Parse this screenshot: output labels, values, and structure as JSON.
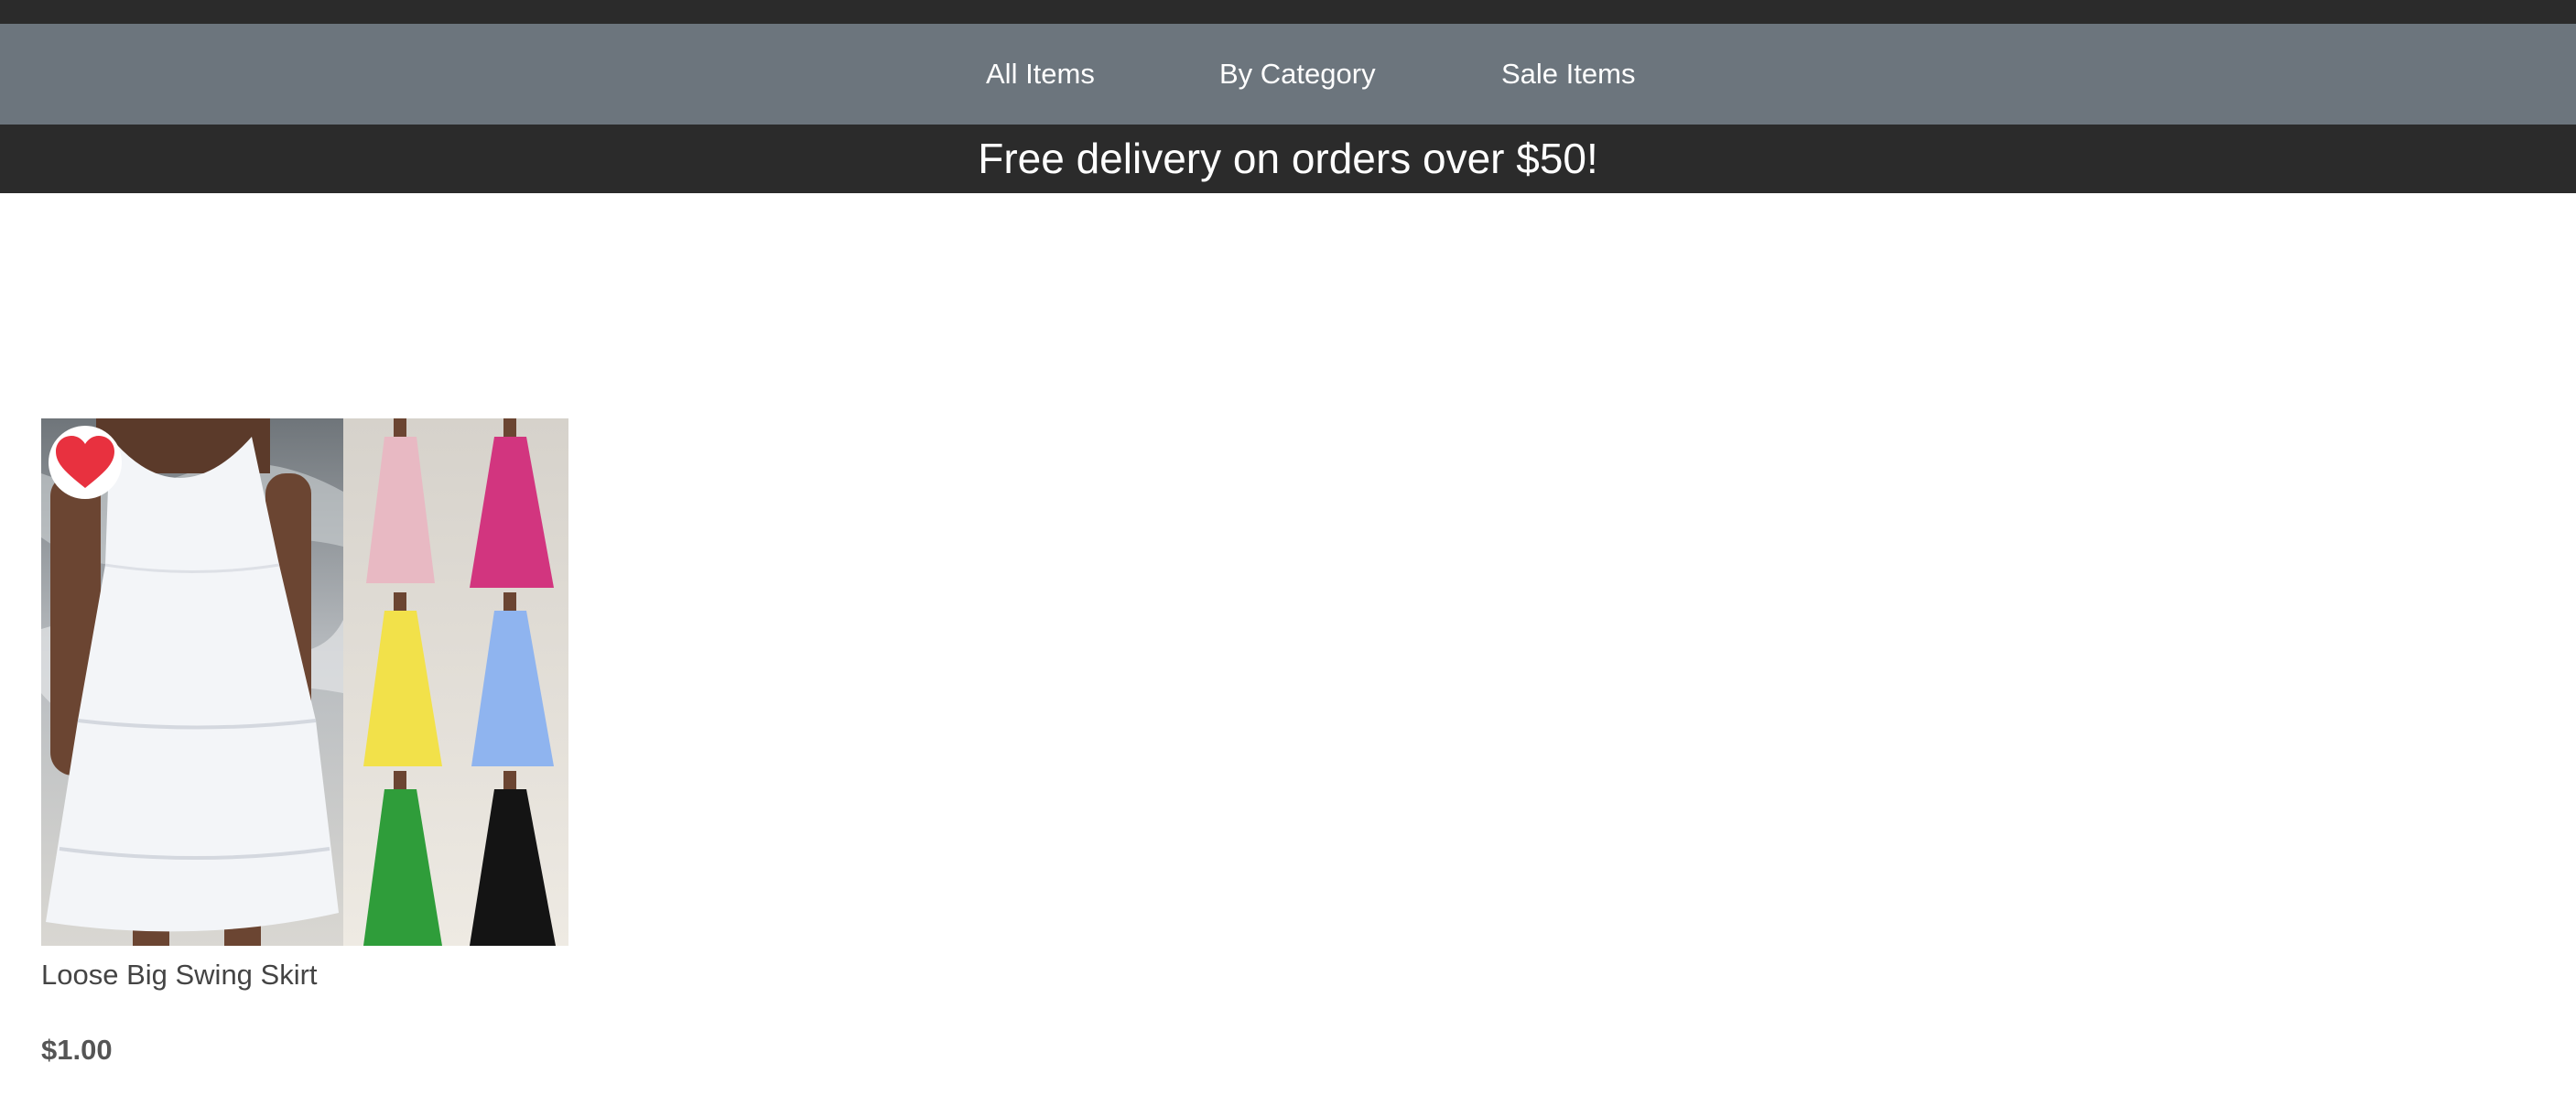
{
  "nav": {
    "items": [
      {
        "label": "All Items"
      },
      {
        "label": "By Category"
      },
      {
        "label": "Sale Items"
      }
    ]
  },
  "banner": {
    "text": "Free delivery on orders over $50!"
  },
  "products": [
    {
      "title": "Loose Big Swing Skirt",
      "price": "$1.00",
      "favorited": true,
      "favorite_icon": "heart-icon",
      "image": "dress-photo",
      "color_variants": [
        "white",
        "pink",
        "magenta",
        "yellow",
        "light-blue",
        "green",
        "black"
      ]
    }
  ],
  "colors": {
    "nav_bg": "#6c757d",
    "dark_bar": "#2b2b2b",
    "heart": "#e8313f",
    "text": "#444444"
  }
}
